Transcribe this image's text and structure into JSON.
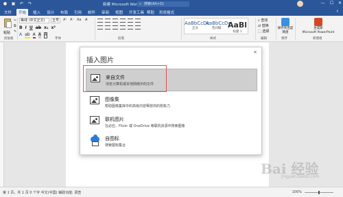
{
  "titlebar": {
    "doc_title": "新建 Microsoft Word 文...",
    "search_placeholder": "搜索(Alt+Q)",
    "minimize": "—",
    "maximize": "☐",
    "close": "✕"
  },
  "tabs": [
    {
      "label": "文件"
    },
    {
      "label": "开始"
    },
    {
      "label": "插入"
    },
    {
      "label": "设计"
    },
    {
      "label": "布局"
    },
    {
      "label": "引用"
    },
    {
      "label": "邮件"
    },
    {
      "label": "审阅"
    },
    {
      "label": "视图"
    },
    {
      "label": "开发工具"
    },
    {
      "label": "帮助"
    },
    {
      "label": "形状格式"
    }
  ],
  "ribbon": {
    "paste_label": "粘贴",
    "clipboard_group": "剪贴板",
    "font_name": "等线 (中文正文)",
    "font_size": "五号",
    "font_group": "字体",
    "paragraph_group": "段落",
    "styles": [
      {
        "sample": "AaBbCcDc",
        "name": "正文"
      },
      {
        "sample": "AaBbCcDc",
        "name": "无间隔"
      },
      {
        "sample": "AaBl",
        "name": "标题 1"
      }
    ],
    "styles_group": "样式",
    "find": "查找",
    "replace": "替换",
    "select": "选择",
    "edit_group": "编辑",
    "save_baidu": "保存到百度网盘",
    "save_group": "保存",
    "new_ppt": "Microsoft PowerPoint",
    "create_label": "生成新",
    "new_group": "新建组"
  },
  "dialog": {
    "title": "插入图片",
    "close": "×",
    "options": [
      {
        "title": "来自文件",
        "desc": "浏览计算机或本地网络中的文件"
      },
      {
        "title": "图像集",
        "desc": "帮助图像集库中的高级内容释放你的想象力"
      },
      {
        "title": "联机图片",
        "desc": "在必应、Flickr 或 OneDrive 等联机资源中搜索图像"
      },
      {
        "title": "自图标",
        "desc": "搜索图标集合"
      }
    ]
  },
  "statusbar": {
    "left": "第 1 页，共 1 页   0 个字   中文(中国)   辅助功能: 调查",
    "zoom": "100%"
  },
  "watermark": {
    "text": "Bai 经验",
    "sub": "jingyan.baidu.com"
  }
}
